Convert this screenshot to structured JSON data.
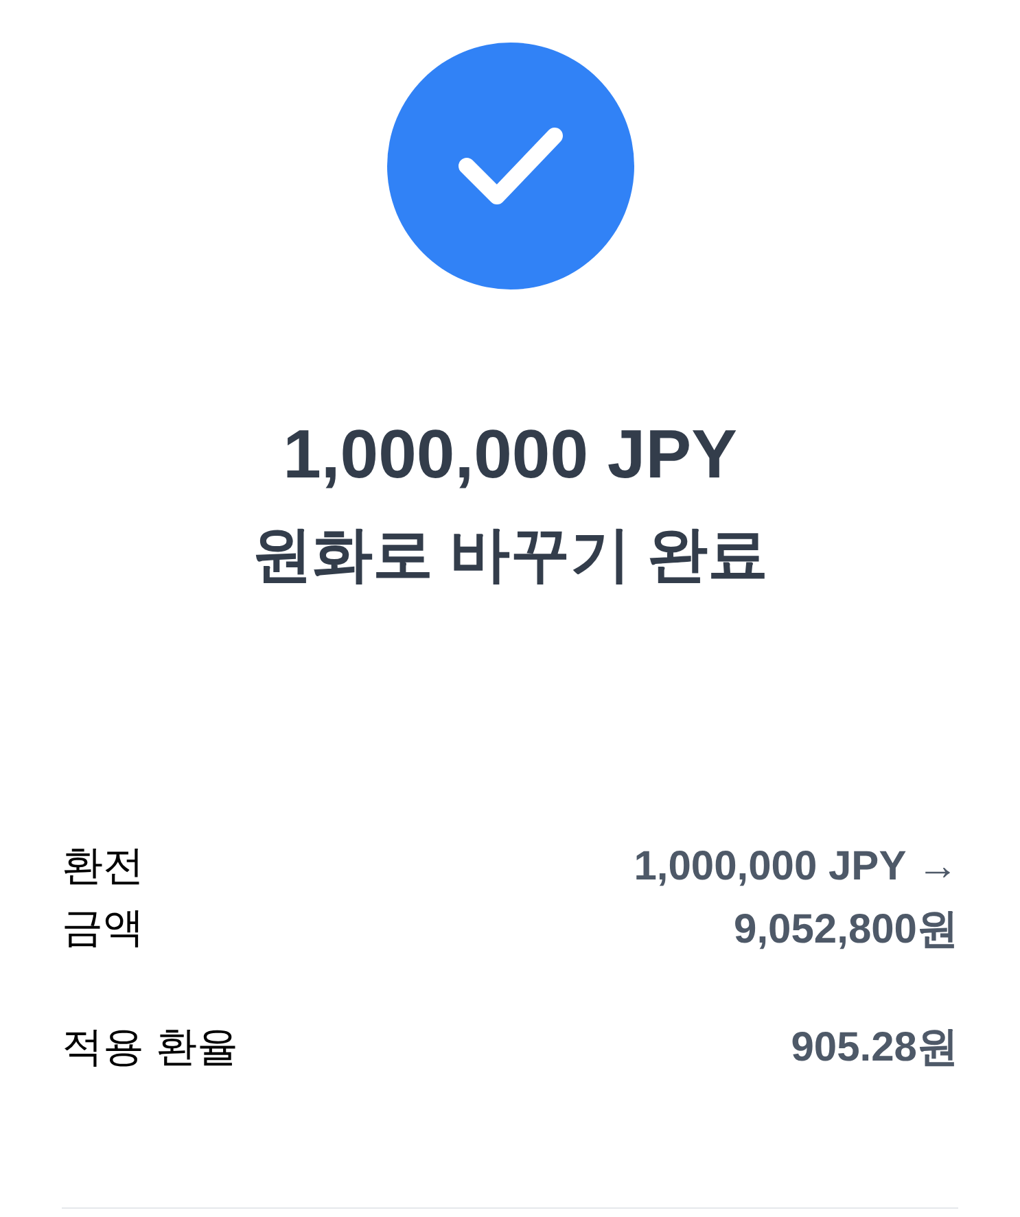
{
  "status": {
    "kind": "success"
  },
  "title": {
    "amount": "1,000,000 JPY",
    "message": "원화로 바꾸기 완료"
  },
  "details": [
    {
      "kind": "wrapped",
      "label": "환전 금액",
      "value": "1,000,000 JPY → 9,052,800원"
    },
    {
      "kind": "single",
      "label": "적용 환율",
      "value": "905.28원"
    }
  ]
}
